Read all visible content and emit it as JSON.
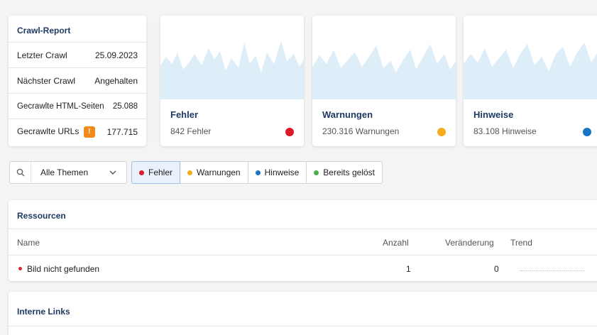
{
  "crawl_report": {
    "title": "Crawl-Report",
    "rows": [
      {
        "label": "Letzter Crawl",
        "value": "25.09.2023"
      },
      {
        "label": "Nächster Crawl",
        "value": "Angehalten"
      },
      {
        "label": "Gecrawlte HTML-Seiten",
        "value": "25.088"
      },
      {
        "label": "Gecrawlte URLs",
        "value": "177.715",
        "badge": "!"
      }
    ]
  },
  "metrics": [
    {
      "title": "Fehler",
      "subtitle": "842 Fehler",
      "color": "#e0192a",
      "icon": "red-status-dot"
    },
    {
      "title": "Warnungen",
      "subtitle": "230.316 Warnungen",
      "color": "#f5ad1f",
      "icon": "yellow-status-dot"
    },
    {
      "title": "Hinweise",
      "subtitle": "83.108 Hinweise",
      "color": "#1a74c4",
      "icon": "blue-status-dot"
    }
  ],
  "filters": {
    "search_icon": "search-icon",
    "topics_select": "Alle Themen",
    "chips": [
      {
        "label": "Fehler",
        "color": "#e0192a",
        "active": true
      },
      {
        "label": "Warnungen",
        "color": "#f5ad1f",
        "active": false
      },
      {
        "label": "Hinweise",
        "color": "#1a74c4",
        "active": false
      },
      {
        "label": "Bereits gelöst",
        "color": "#49b04a",
        "active": false
      }
    ]
  },
  "ressourcen": {
    "title": "Ressourcen",
    "columns": {
      "name": "Name",
      "count": "Anzahl",
      "change": "Veränderung",
      "trend": "Trend"
    },
    "rows": [
      {
        "name": "Bild nicht gefunden",
        "count": "1",
        "change": "0"
      }
    ]
  },
  "interne_links": {
    "title": "Interne Links"
  }
}
